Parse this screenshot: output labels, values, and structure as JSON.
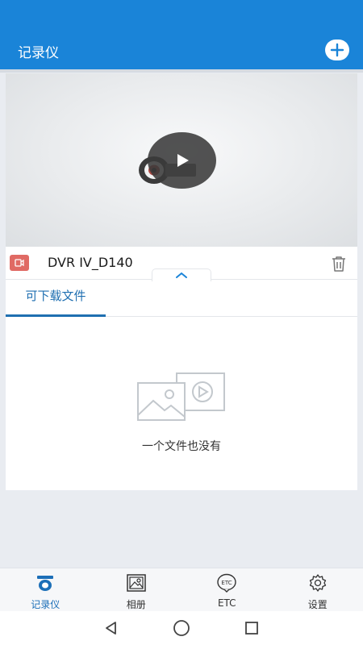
{
  "colors": {
    "primary": "#1a84d8",
    "tab_active": "#1f6fb1",
    "badge": "#e06a64"
  },
  "header": {
    "title": "记录仪",
    "add_icon": "plus-icon"
  },
  "video": {
    "play_icon": "play-icon"
  },
  "device": {
    "name": "DVR IV_D140",
    "badge_icon": "dvr-icon",
    "delete_icon": "trash-icon",
    "collapse_icon": "chevron-up-icon"
  },
  "tabs": [
    {
      "label": "可下载文件",
      "active": true
    }
  ],
  "empty_state": {
    "text": "一个文件也没有",
    "icon": "image-video-placeholder-icon"
  },
  "bottom_nav": [
    {
      "label": "记录仪",
      "icon": "recorder-icon",
      "active": true
    },
    {
      "label": "相册",
      "icon": "album-icon",
      "active": false
    },
    {
      "label": "ETC",
      "icon": "etc-icon",
      "active": false
    },
    {
      "label": "设置",
      "icon": "gear-icon",
      "active": false
    }
  ],
  "system_nav": {
    "back": "back-icon",
    "home": "home-icon",
    "recents": "recents-icon"
  }
}
